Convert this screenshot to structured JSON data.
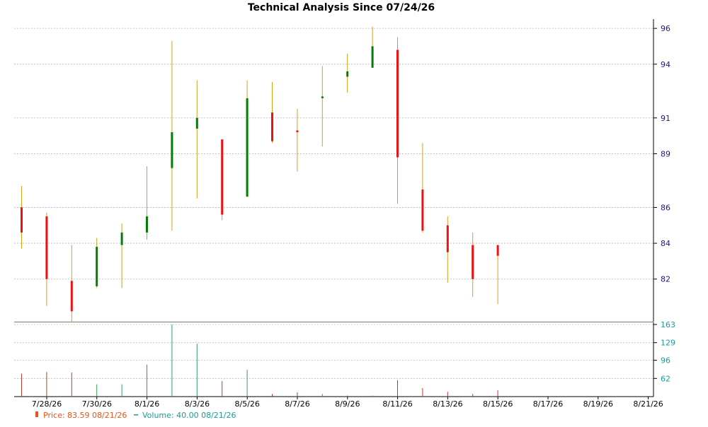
{
  "chart_data": {
    "type": "candlestick",
    "title": "Technical Analysis Since 07/24/26",
    "price_axis": {
      "ticks": [
        82,
        84,
        86,
        89,
        91,
        94,
        96
      ],
      "ylim": [
        79.7,
        96.4
      ],
      "side": "right"
    },
    "volume_axis": {
      "ticks": [
        62,
        96,
        129,
        163
      ],
      "ylim": [
        28,
        163
      ],
      "side": "right"
    },
    "x_ticks": [
      "7/28/26",
      "7/30/26",
      "8/1/26",
      "8/3/26",
      "8/5/26",
      "8/7/26",
      "8/9/26",
      "8/11/26",
      "8/13/26",
      "8/15/26",
      "8/17/26",
      "8/19/26",
      "8/21/26"
    ],
    "grid": true,
    "up_color": "#008000",
    "down_color": "#ee1111",
    "wick_color": "#d4a017",
    "vol_up_color": "#2e9e5e",
    "vol_down_color": "#c0392b",
    "candles": [
      {
        "date": "7/27/26",
        "open": 86.0,
        "high": 87.2,
        "low": 83.7,
        "close": 84.6,
        "volume": 71
      },
      {
        "date": "7/28/26",
        "open": 85.5,
        "high": 85.7,
        "low": 80.5,
        "close": 82.0,
        "volume": 74
      },
      {
        "date": "7/29/26",
        "open": 81.9,
        "high": 83.9,
        "low": 79.6,
        "close": 80.2,
        "volume": 73
      },
      {
        "date": "7/30/26",
        "open": 81.6,
        "high": 84.3,
        "low": 81.5,
        "close": 83.8,
        "volume": 51
      },
      {
        "date": "7/31/26",
        "open": 83.9,
        "high": 85.1,
        "low": 81.5,
        "close": 84.6,
        "volume": 51
      },
      {
        "date": "8/3/26",
        "open": 84.6,
        "high": 88.3,
        "low": 84.2,
        "close": 85.5,
        "volume": 88
      },
      {
        "date": "8/4/26",
        "open": 88.2,
        "high": 95.3,
        "low": 84.7,
        "close": 90.2,
        "volume": 163
      },
      {
        "date": "8/5/26",
        "open": 90.4,
        "high": 93.1,
        "low": 86.5,
        "close": 91.0,
        "volume": 127
      },
      {
        "date": "8/6/26",
        "open": 89.8,
        "high": 89.6,
        "low": 85.3,
        "close": 85.6,
        "volume": 57
      },
      {
        "date": "8/7/26",
        "open": 86.6,
        "high": 93.1,
        "low": 86.6,
        "close": 92.1,
        "volume": 78
      },
      {
        "date": "8/10/26",
        "open": 91.3,
        "high": 93.0,
        "low": 89.6,
        "close": 89.7,
        "volume": 33
      },
      {
        "date": "8/11/26",
        "open": 90.3,
        "high": 91.5,
        "low": 88.0,
        "close": 90.2,
        "volume": 36
      },
      {
        "date": "8/12/26",
        "open": 92.1,
        "high": 93.9,
        "low": 89.4,
        "close": 92.2,
        "volume": 33
      },
      {
        "date": "8/13/26",
        "open": 93.3,
        "high": 94.6,
        "low": 92.4,
        "close": 93.6,
        "volume": 30
      },
      {
        "date": "8/14/26",
        "open": 93.8,
        "high": 96.1,
        "low": 93.8,
        "close": 95.0,
        "volume": 30
      },
      {
        "date": "8/17/26",
        "open": 94.8,
        "high": 95.5,
        "low": 86.2,
        "close": 88.8,
        "volume": 59
      },
      {
        "date": "8/18/26",
        "open": 87.0,
        "high": 89.6,
        "low": 84.6,
        "close": 84.7,
        "volume": 44
      },
      {
        "date": "8/19/26",
        "open": 85.0,
        "high": 85.5,
        "low": 81.8,
        "close": 83.5,
        "volume": 37
      },
      {
        "date": "8/20/26",
        "open": 83.9,
        "high": 84.6,
        "low": 81.0,
        "close": 82.0,
        "volume": 33
      },
      {
        "date": "8/21/26",
        "open": 83.9,
        "high": 83.5,
        "low": 80.6,
        "close": 83.3,
        "volume": 40
      }
    ]
  },
  "legend": {
    "price": "Price: 83.59  08/21/26",
    "volume": "Volume: 40.00  08/21/26"
  }
}
